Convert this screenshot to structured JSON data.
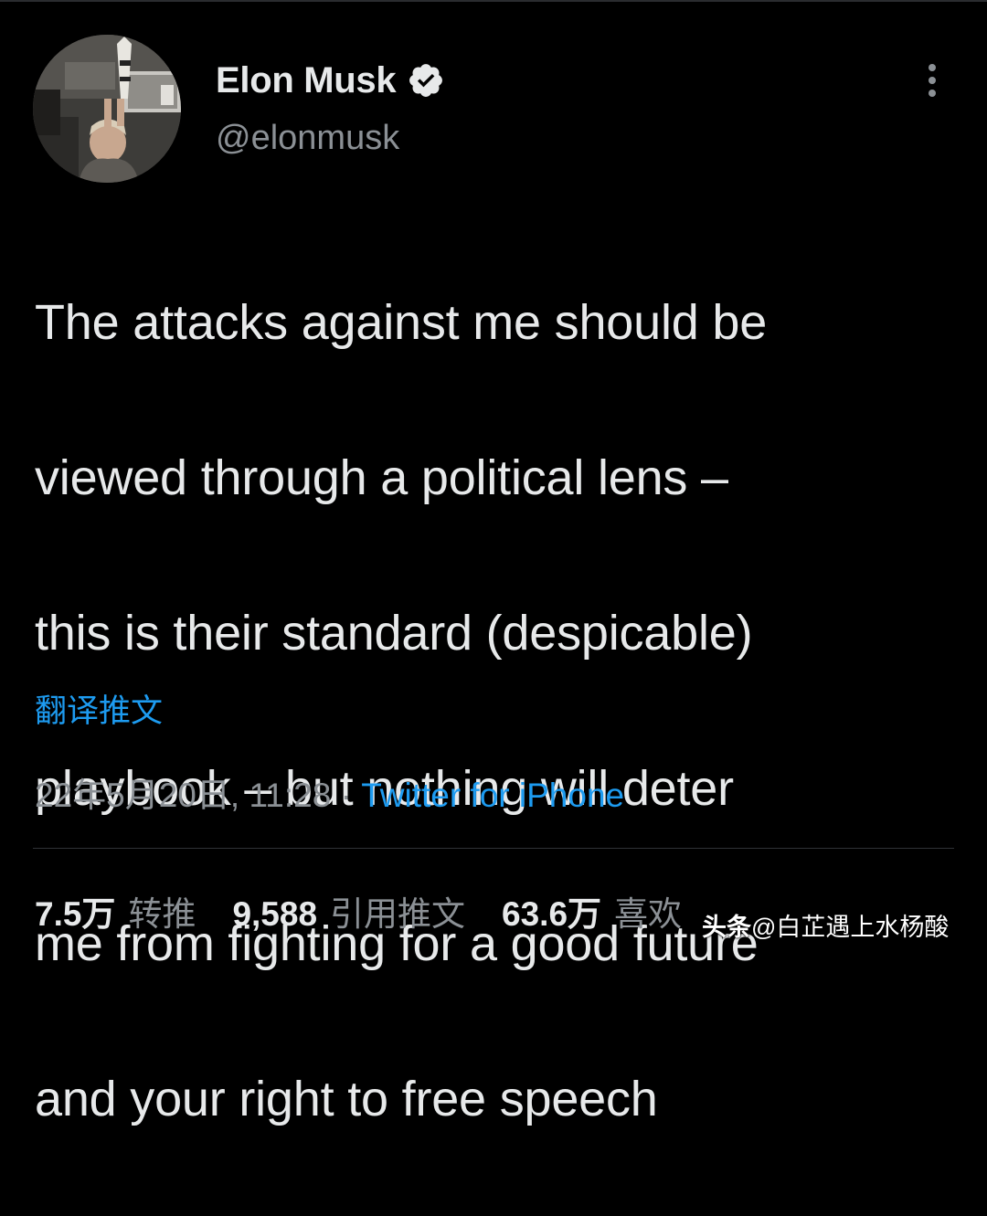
{
  "author": {
    "name": "Elon Musk",
    "handle": "@elonmusk",
    "avatar_icon": "profile-photo",
    "verified_icon": "verified-badge-icon"
  },
  "tweet": {
    "lines": [
      "The attacks against me should be",
      "viewed through a political lens –",
      "this is their standard (despicable)",
      "playbook – but nothing will deter",
      "me from fighting for a good future",
      "and your right to free speech"
    ],
    "translate_label": "翻译推文"
  },
  "meta": {
    "datetime": "22年5月20日, 11:28",
    "separator": "·",
    "source": "Twitter for iPhone"
  },
  "stats": {
    "retweets_count": "7.5万",
    "retweets_label": "转推",
    "quotes_count": "9,588",
    "quotes_label": "引用推文",
    "likes_count": "63.6万",
    "likes_label": "喜欢"
  },
  "watermark": {
    "logo": "头条",
    "text": "@白芷遇上水杨酸"
  },
  "colors": {
    "background": "#000000",
    "text": "#e7e9ea",
    "secondary": "#8b9095",
    "accent": "#1d9bf0"
  }
}
